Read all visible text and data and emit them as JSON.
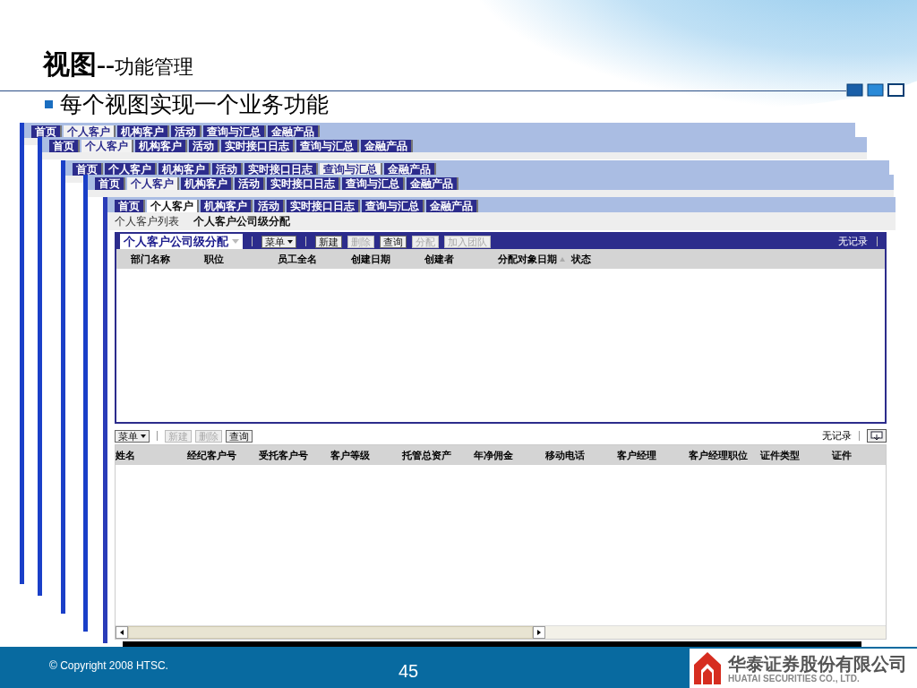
{
  "slide": {
    "title": "视图--",
    "title_suffix": "功能管理",
    "bullet": "每个视图实现一个业务功能"
  },
  "back_windows": [
    {
      "tabs": [
        {
          "label": "首页",
          "selected": false
        },
        {
          "label": "个人客户",
          "selected": true
        },
        {
          "label": "机构客户",
          "selected": false
        },
        {
          "label": "活动",
          "selected": false
        },
        {
          "label": "查询与汇总",
          "selected": false
        },
        {
          "label": "金融产品",
          "selected": false
        }
      ]
    },
    {
      "tabs": [
        {
          "label": "首页",
          "selected": false
        },
        {
          "label": "个人客户",
          "selected": true
        },
        {
          "label": "机构客户",
          "selected": false
        },
        {
          "label": "活动",
          "selected": false
        },
        {
          "label": "实时接口日志",
          "selected": false
        },
        {
          "label": "查询与汇总",
          "selected": false
        },
        {
          "label": "金融产品",
          "selected": false
        }
      ]
    },
    {
      "tabs": [
        {
          "label": "首页",
          "selected": false
        },
        {
          "label": "个人客户",
          "selected": false
        },
        {
          "label": "机构客户",
          "selected": false
        },
        {
          "label": "活动",
          "selected": false
        },
        {
          "label": "实时接口日志",
          "selected": false
        },
        {
          "label": "查询与汇总",
          "selected": true
        },
        {
          "label": "金融产品",
          "selected": false
        }
      ]
    },
    {
      "tabs": [
        {
          "label": "首页",
          "selected": false
        },
        {
          "label": "个人客户",
          "selected": true
        },
        {
          "label": "机构客户",
          "selected": false
        },
        {
          "label": "活动",
          "selected": false
        },
        {
          "label": "实时接口日志",
          "selected": false
        },
        {
          "label": "查询与汇总",
          "selected": false
        },
        {
          "label": "金融产品",
          "selected": false
        }
      ]
    }
  ],
  "front": {
    "tabs": [
      {
        "label": "首页",
        "selected": false
      },
      {
        "label": "个人客户",
        "selected": true
      },
      {
        "label": "机构客户",
        "selected": false
      },
      {
        "label": "活动",
        "selected": false
      },
      {
        "label": "实时接口日志",
        "selected": false
      },
      {
        "label": "查询与汇总",
        "selected": false
      },
      {
        "label": "金融产品",
        "selected": false
      }
    ],
    "subnav": [
      {
        "label": "个人客户列表",
        "selected": false
      },
      {
        "label": "个人客户公司级分配",
        "selected": true
      }
    ],
    "upper": {
      "view_select": "个人客户公司级分配",
      "menu": "菜单",
      "buttons": [
        {
          "label": "新建",
          "disabled": false
        },
        {
          "label": "删除",
          "disabled": true
        },
        {
          "label": "查询",
          "disabled": false
        },
        {
          "label": "分配",
          "disabled": true
        },
        {
          "label": "加入团队",
          "disabled": true
        }
      ],
      "status": "无记录",
      "columns": [
        {
          "label": "部门名称",
          "sorted": false
        },
        {
          "label": "职位",
          "sorted": false
        },
        {
          "label": "员工全名",
          "sorted": false
        },
        {
          "label": "创建日期",
          "sorted": false
        },
        {
          "label": "创建者",
          "sorted": false
        },
        {
          "label": "分配对象日期",
          "sorted": true
        },
        {
          "label": "状态",
          "sorted": false
        }
      ]
    },
    "lower": {
      "menu": "菜单",
      "buttons": [
        {
          "label": "新建",
          "disabled": true
        },
        {
          "label": "删除",
          "disabled": true
        },
        {
          "label": "查询",
          "disabled": false
        }
      ],
      "status": "无记录",
      "columns": [
        "姓名",
        "经纪客户号",
        "受托客户号",
        "客户等级",
        "托管总资产",
        "年净佣金",
        "移动电话",
        "客户经理",
        "客户经理职位",
        "证件类型",
        "证件"
      ]
    }
  },
  "footer": {
    "copyright": "© Copyright 2008 HTSC.",
    "page_number": "45",
    "company": "华泰证券股份有限公司",
    "company_en": "HUATAI SECURITIES CO., LTD."
  }
}
